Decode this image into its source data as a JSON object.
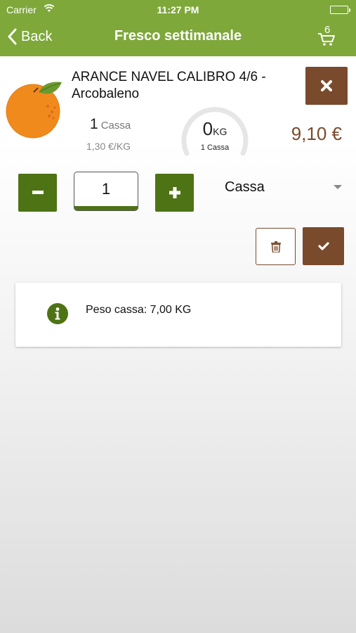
{
  "status_bar": {
    "carrier": "Carrier",
    "time": "11:27 PM"
  },
  "nav": {
    "back_label": "Back",
    "title": "Fresco settimanale",
    "cart_count": "6"
  },
  "product": {
    "name": "ARANCE NAVEL CALIBRO 4/6 - Arcobaleno",
    "quantity": "1",
    "quantity_unit": "Cassa",
    "unit_price": "1,30 €/KG",
    "weight_value": "0",
    "weight_unit": "KG",
    "weight_caption": "1 Cassa",
    "total_price": "9,10 €"
  },
  "editor": {
    "quantity_value": "1",
    "selected_unit": "Cassa"
  },
  "info": {
    "text": "Peso cassa: 7,00 KG"
  },
  "colors": {
    "header_green": "#7ea83a",
    "dark_green": "#4e7315",
    "brown": "#7a4a2c"
  },
  "icons": {
    "back": "chevron-left-icon",
    "cart": "cart-icon",
    "remove": "close-icon",
    "minus": "minus-icon",
    "plus": "plus-icon",
    "trash": "trash-icon",
    "confirm": "check-icon",
    "info": "info-icon"
  }
}
